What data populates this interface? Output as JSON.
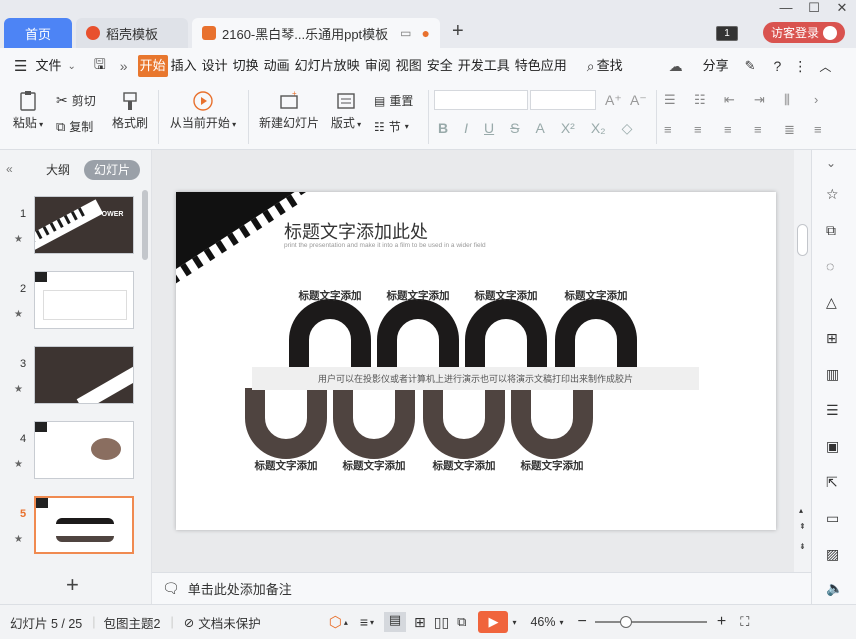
{
  "tabs": {
    "home": "首页",
    "daoke": "稻壳模板",
    "doc": "2160-黑白琴...乐通用ppt模板"
  },
  "window": {
    "badge": "1",
    "login": "访客登录"
  },
  "menu": {
    "file": "文件",
    "items": [
      "开始",
      "插入",
      "设计",
      "切换",
      "动画",
      "幻灯片放映",
      "审阅",
      "视图",
      "安全",
      "开发工具",
      "特色应用"
    ],
    "search": "查找",
    "share": "分享"
  },
  "ribbon": {
    "paste": "粘贴",
    "cut": "剪切",
    "copy": "复制",
    "format_painter": "格式刷",
    "play_from_current": "从当前开始",
    "new_slide": "新建幻灯片",
    "layout": "版式",
    "reset": "重置",
    "section": "节"
  },
  "panel": {
    "outline": "大纲",
    "slides": "幻灯片"
  },
  "thumbnails": [
    {
      "num": "1",
      "title": "POWER"
    },
    {
      "num": "2",
      "title": ""
    },
    {
      "num": "3",
      "title": ""
    },
    {
      "num": "4",
      "title": ""
    },
    {
      "num": "5",
      "title": ""
    }
  ],
  "slide": {
    "title": "标题文字添加此处",
    "subtitle": "print the presentation and make it into a film to be used in a wider field",
    "band_text": "用户可以在投影仪或者计算机上进行演示也可以将演示文稿打印出来制作成胶片",
    "top_labels": [
      "标题文字添加",
      "标题文字添加",
      "标题文字添加",
      "标题文字添加"
    ],
    "bottom_labels": [
      "标题文字添加",
      "标题文字添加",
      "标题文字添加",
      "标题文字添加"
    ],
    "colors": {
      "black": "#1c1a1a",
      "brown": "#4f4440",
      "band": "#efefef"
    }
  },
  "notes": {
    "placeholder": "单击此处添加备注"
  },
  "status": {
    "slide_counter": "幻灯片 5 / 25",
    "theme": "包图主题2",
    "protection": "文档未保护",
    "zoom": "46%"
  }
}
